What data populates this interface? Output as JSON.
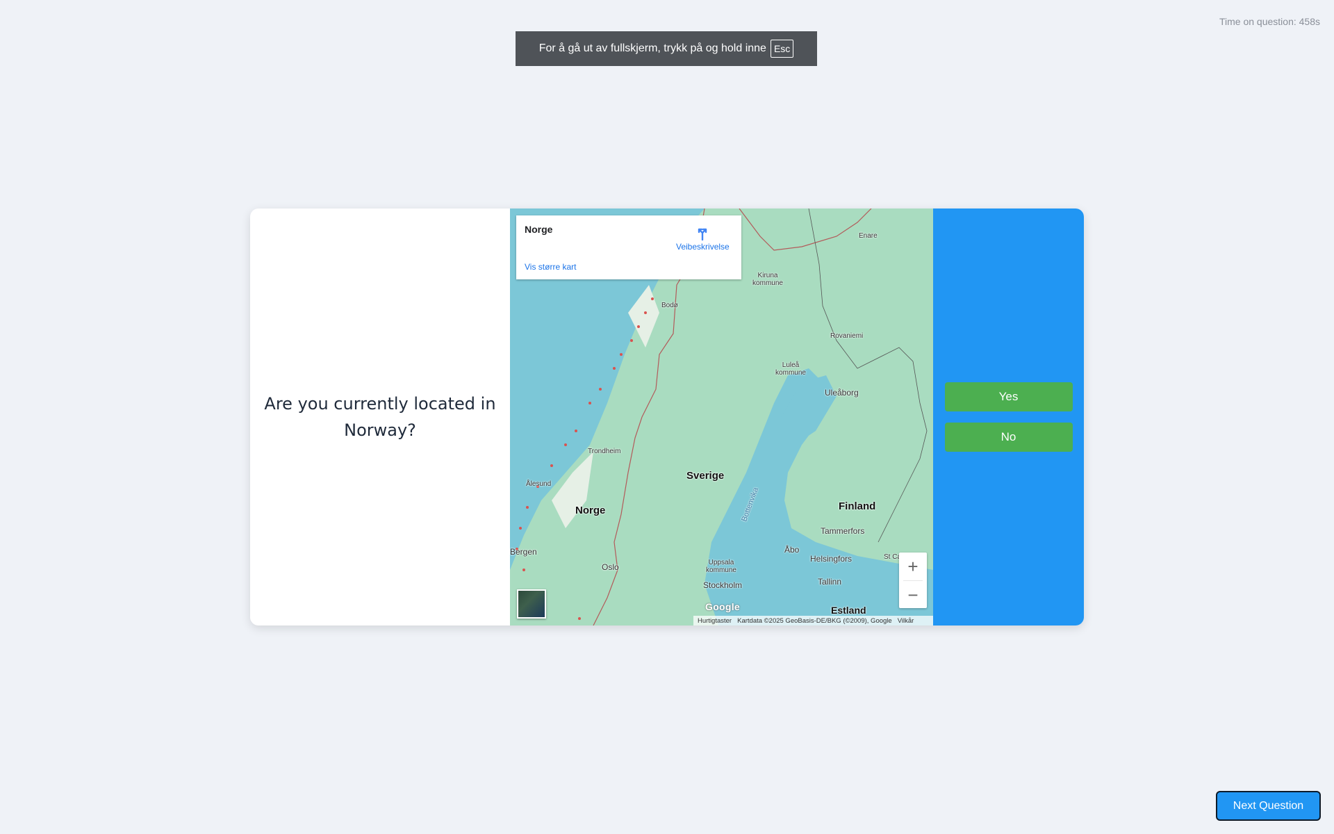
{
  "timer": {
    "label": "Time on question: 458s"
  },
  "fullscreen_notice": {
    "text": "For å gå ut av fullskjerm, trykk på og hold inne",
    "key": "Esc"
  },
  "question": {
    "text": "Are you currently located in Norway?"
  },
  "map": {
    "infocard": {
      "place": "Norge",
      "directions_label": "Veibeskrivelse",
      "larger_map_link": "Vis større kart"
    },
    "labels": {
      "enare": "Enare",
      "kiruna": "Kiruna kommune",
      "boda": "Bodø",
      "rovaniemi": "Rovaniemi",
      "lulea": "Luleå kommune",
      "uleaborg": "Uleåborg",
      "trondheim": "Trondheim",
      "sverige": "Sverige",
      "alesund": "Ålesund",
      "norge": "Norge",
      "finland": "Finland",
      "bottenvika": "Bottenvika",
      "tammerfors": "Tammerfors",
      "bergen": "Bergen",
      "oslo": "Oslo",
      "uppsala": "Uppsala kommune",
      "abo": "Åbo",
      "helsingfors": "Helsingfors",
      "stockholm": "Stockholm",
      "tallinn": "Tallinn",
      "estland": "Estland",
      "st_petersburg_partial": "St Санкт"
    },
    "zoom_in": "+",
    "zoom_out": "−",
    "logo": "Google",
    "attribution": {
      "shortcuts": "Hurtigtaster",
      "data": "Kartdata ©2025 GeoBasis-DE/BKG (©2009), Google",
      "terms": "Vilkår"
    }
  },
  "answers": {
    "yes": "Yes",
    "no": "No"
  },
  "next_button": "Next Question",
  "colors": {
    "page_bg": "#eff2f7",
    "answer_pane": "#2196f3",
    "answer_button": "#4caf50",
    "next_button": "#2196f3",
    "water": "#7cc7d7",
    "land": "#a9dcc0"
  }
}
